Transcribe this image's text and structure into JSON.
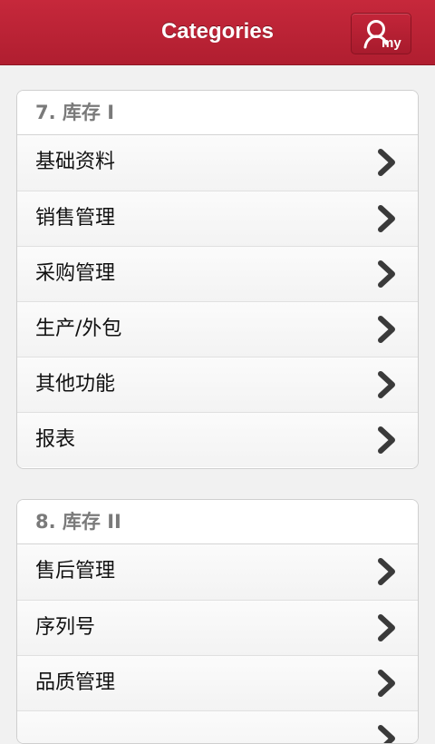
{
  "header": {
    "title": "Categories",
    "my_button_text": "my"
  },
  "groups": [
    {
      "title": "7. 库存 I",
      "items": [
        "基础资料",
        "销售管理",
        "采购管理",
        "生产/外包",
        "其他功能",
        "报表"
      ]
    },
    {
      "title": "8. 库存 II",
      "items": [
        "售后管理",
        "序列号",
        "品质管理"
      ]
    }
  ],
  "icons": {
    "my_button": "user-icon",
    "row_arrow": "chevron-right-icon"
  },
  "colors": {
    "header": "#c0243a",
    "chevron": "#3a3a3a",
    "group_title": "#7a7a7a"
  }
}
